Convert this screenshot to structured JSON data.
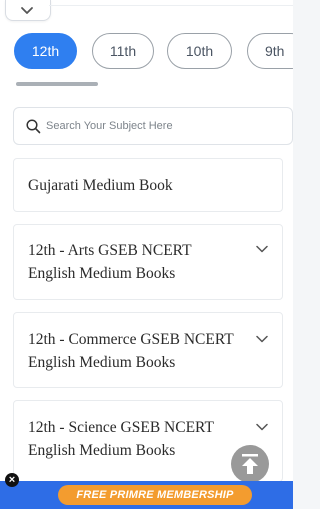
{
  "header": {
    "collapse_icon": "chevron-down-icon"
  },
  "grades": [
    {
      "label": "12th",
      "active": true
    },
    {
      "label": "11th",
      "active": false
    },
    {
      "label": "10th",
      "active": false
    },
    {
      "label": "9th",
      "active": false
    }
  ],
  "search": {
    "placeholder": "Search Your Subject Here",
    "icon": "search-icon"
  },
  "cards": [
    {
      "title": "Gujarati Medium Book",
      "has_chevron": false
    },
    {
      "title": "12th - Arts GSEB NCERT\nEnglish Medium Books",
      "has_chevron": true
    },
    {
      "title": "12th - Commerce GSEB NCERT\nEnglish Medium Books",
      "has_chevron": true
    },
    {
      "title": "12th - Science GSEB NCERT\nEnglish Medium Books",
      "has_chevron": true
    }
  ],
  "scroll_top_icon": "arrow-up-to-top-icon",
  "banner": {
    "text": "FREE PRIMRE MEMBERSHIP",
    "close_label": "×"
  },
  "colors": {
    "accent": "#2f7ff0",
    "banner_bg": "#2e6de6",
    "banner_pill": "#f39c2f"
  }
}
